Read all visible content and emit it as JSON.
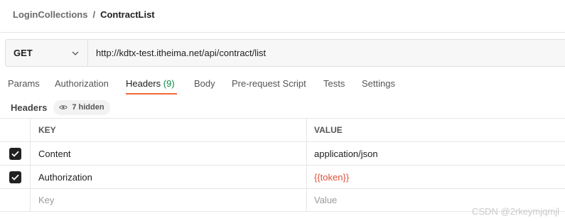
{
  "breadcrumb": {
    "collection": "LoginCollections",
    "separator": "/",
    "request": "ContractList"
  },
  "request": {
    "method": "GET",
    "url": "http://kdtx-test.itheima.net/api/contract/list"
  },
  "tabs": [
    {
      "label": "Params"
    },
    {
      "label": "Authorization"
    },
    {
      "label": "Headers",
      "count": "(9)",
      "active": true
    },
    {
      "label": "Body"
    },
    {
      "label": "Pre-request Script"
    },
    {
      "label": "Tests"
    },
    {
      "label": "Settings"
    }
  ],
  "headers_section": {
    "title": "Headers",
    "hidden_label": "7 hidden"
  },
  "table": {
    "columns": {
      "key": "KEY",
      "value": "VALUE"
    },
    "rows": [
      {
        "checked": true,
        "key": "Content",
        "value": "application/json"
      },
      {
        "checked": true,
        "key": "Authorization",
        "value": "{{token}}"
      }
    ],
    "new_row": {
      "key_placeholder": "Key",
      "value_placeholder": "Value"
    }
  },
  "watermark": "CSDN @2rkeymjqmjl",
  "colors": {
    "active_tab_underline": "#f26b3a",
    "count": "#0c8a4a",
    "variable": "#e0533a"
  }
}
